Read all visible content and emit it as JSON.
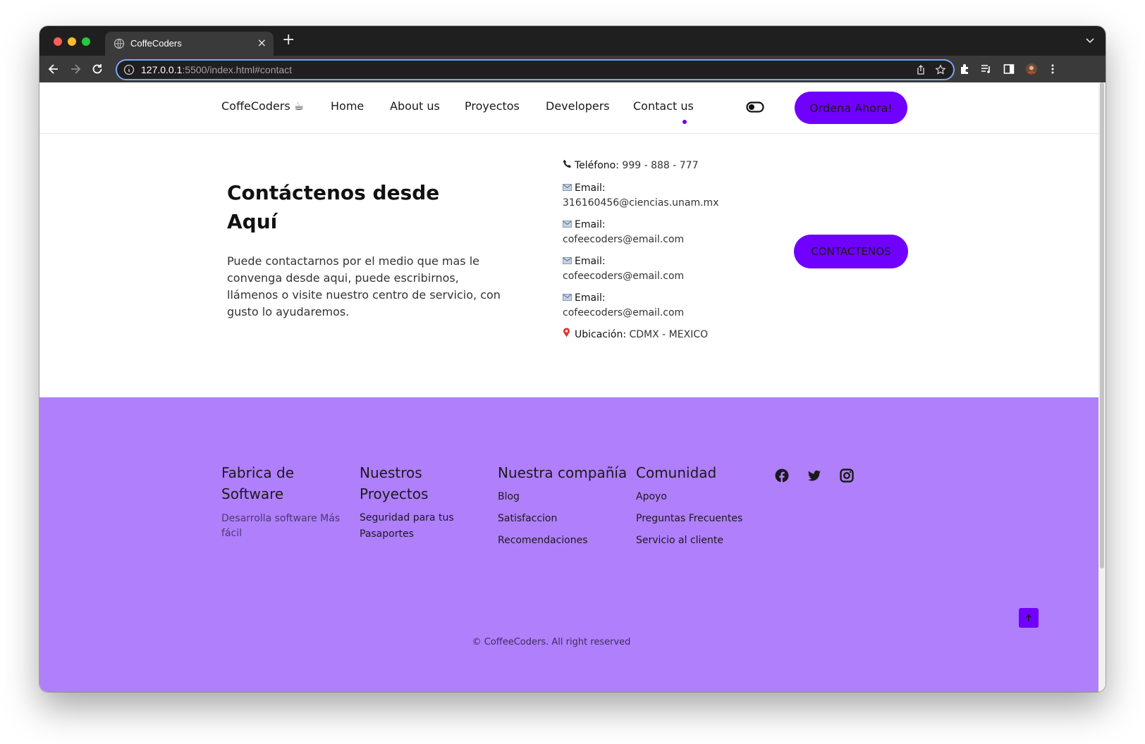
{
  "browser": {
    "tab_title": "CoffeCoders",
    "url_host": "127.0.0.1",
    "url_rest": ":5500/index.html#contact"
  },
  "nav": {
    "brand": "CoffeCoders ☕",
    "links": [
      "Home",
      "About us",
      "Proyectos",
      "Developers",
      "Contact us"
    ],
    "active": "Contact us",
    "cta": "Ordena Ahora!"
  },
  "contact": {
    "title": "Contáctenos desde Aquí",
    "description": "Puede contactarnos por el medio que mas le convenga desde aqui, puede escribirnos, llámenos o visite nuestro centro de servicio, con gusto lo ayudaremos.",
    "items": [
      {
        "icon": "phone-icon",
        "label": "Teléfono:",
        "value": "999 - 888 - 777"
      },
      {
        "icon": "envelope-icon",
        "label": "Email:",
        "value": "316160456@ciencias.unam.mx"
      },
      {
        "icon": "envelope-icon",
        "label": "Email:",
        "value": "cofeecoders@email.com"
      },
      {
        "icon": "envelope-icon",
        "label": "Email:",
        "value": "cofeecoders@email.com"
      },
      {
        "icon": "envelope-icon",
        "label": "Email:",
        "value": "cofeecoders@email.com"
      },
      {
        "icon": "pin-icon",
        "label": "Ubicación:",
        "value": "CDMX - MEXICO"
      }
    ],
    "button": "CONTACTENOS"
  },
  "footer": {
    "columns": [
      {
        "title": "Fabrica de Software",
        "subtitle": "Desarrolla software Más fácil",
        "links": []
      },
      {
        "title": "Nuestros Proyectos",
        "links": [
          "Seguridad para tus Pasaportes"
        ]
      },
      {
        "title": "Nuestra compañía",
        "links": [
          "Blog",
          "Satisfaccion",
          "Recomendaciones"
        ]
      },
      {
        "title": "Comunidad",
        "links": [
          "Apoyo",
          "Preguntas Frecuentes",
          "Servicio al cliente"
        ]
      }
    ],
    "social": [
      "facebook-icon",
      "twitter-icon",
      "instagram-icon"
    ],
    "copyright": "© CoffeeCoders. All right reserved"
  },
  "colors": {
    "accent": "#7000ff",
    "footer_bg": "#b07ffc",
    "chrome_dark": "#1f1f1f"
  }
}
